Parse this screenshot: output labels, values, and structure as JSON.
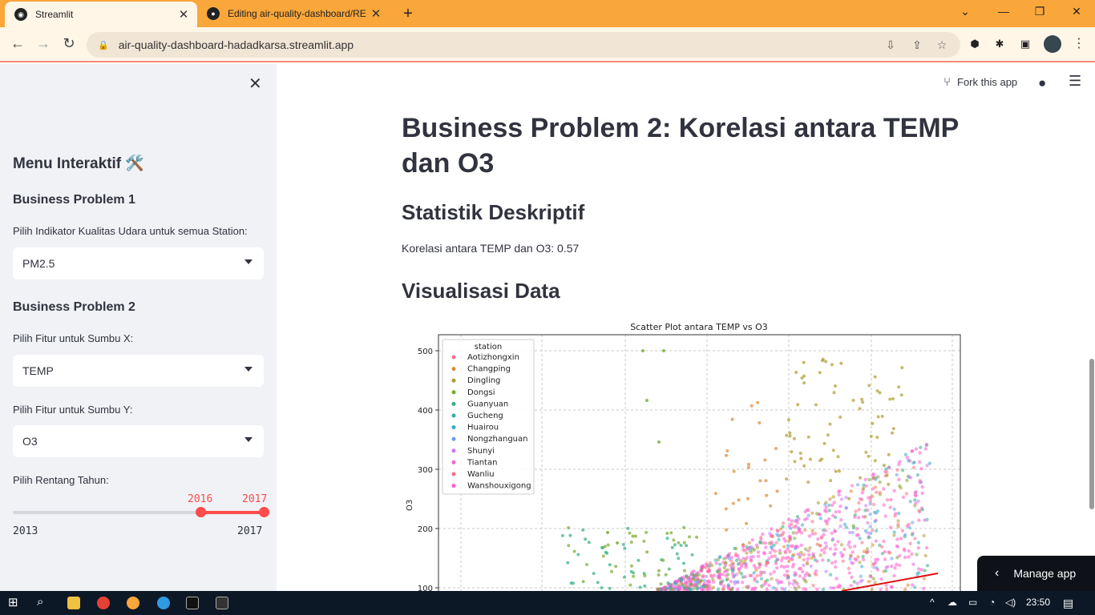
{
  "browser": {
    "tabs": [
      {
        "title": "Streamlit",
        "active": true
      },
      {
        "title": "Editing air-quality-dashboard/RE",
        "active": false
      }
    ],
    "url": "air-quality-dashboard-hadadkarsa.streamlit.app"
  },
  "sidebar": {
    "menu_title": "Menu Interaktif 🛠️",
    "bp1": {
      "heading": "Business Problem 1",
      "label": "Pilih Indikator Kualitas Udara untuk semua Station:",
      "selected": "PM2.5"
    },
    "bp2": {
      "heading": "Business Problem 2",
      "x_label": "Pilih Fitur untuk Sumbu X:",
      "x_selected": "TEMP",
      "y_label": "Pilih Fitur untuk Sumbu Y:",
      "y_selected": "O3",
      "range_label": "Pilih Rentang Tahun:",
      "range_start": "2016",
      "range_end": "2017",
      "range_min": "2013",
      "range_max": "2017"
    }
  },
  "header": {
    "fork_label": "Fork this app"
  },
  "main": {
    "title": "Business Problem 2: Korelasi antara TEMP dan O3",
    "stats_heading": "Statistik Deskriptif",
    "correlation_text": "Korelasi antara TEMP dan O3: 0.57",
    "viz_heading": "Visualisasi Data"
  },
  "chart_data": {
    "type": "scatter",
    "title": "Scatter Plot antara TEMP vs O3",
    "ylabel": "O3",
    "yticks": [
      100,
      200,
      300,
      400,
      500
    ],
    "legend_title": "station",
    "legend_placement": "top-left",
    "grid": true,
    "series": [
      {
        "name": "Aotizhongxin",
        "color": "#f77189"
      },
      {
        "name": "Changping",
        "color": "#dc8932"
      },
      {
        "name": "Dingling",
        "color": "#ae9d31"
      },
      {
        "name": "Dongsi",
        "color": "#77ab31"
      },
      {
        "name": "Guanyuan",
        "color": "#33b07a"
      },
      {
        "name": "Gucheng",
        "color": "#36ada4"
      },
      {
        "name": "Huairou",
        "color": "#38a9c5"
      },
      {
        "name": "Nongzhanguan",
        "color": "#6e9bf4"
      },
      {
        "name": "Shunyi",
        "color": "#cc7af4"
      },
      {
        "name": "Tiantan",
        "color": "#f565cc"
      },
      {
        "name": "Wanliu",
        "color": "#f77189"
      },
      {
        "name": "Wanshouxigong",
        "color": "#ff59d0"
      }
    ],
    "regression_color": "#e01010"
  },
  "manage_label": "Manage app",
  "taskbar": {
    "time": "23:50"
  }
}
